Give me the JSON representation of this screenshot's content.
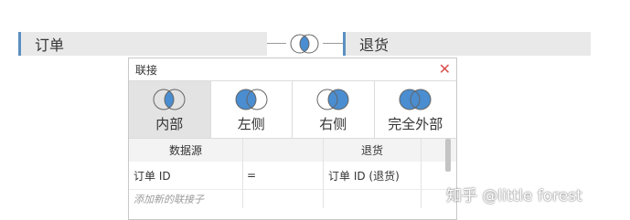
{
  "canvas": {
    "left_table": "订单",
    "right_table": "退货",
    "accent_color": "#5b8fc1",
    "join_fill_color": "#4a8dd0"
  },
  "dialog": {
    "title": "联接",
    "close_icon": "close-icon",
    "join_types": [
      {
        "label": "内部",
        "icon": "inner-join-icon",
        "selected": true
      },
      {
        "label": "左侧",
        "icon": "left-join-icon",
        "selected": false
      },
      {
        "label": "右侧",
        "icon": "right-join-icon",
        "selected": false
      },
      {
        "label": "完全外部",
        "icon": "full-outer-join-icon",
        "selected": false
      }
    ],
    "columns": {
      "left": "数据源",
      "operator": "",
      "right": "退货"
    },
    "clauses": [
      {
        "left": "订单 ID",
        "operator": "=",
        "right": "订单 ID (退货)"
      }
    ],
    "add_clause_placeholder": "添加新的联接子"
  },
  "watermark": "知乎 @little forest"
}
